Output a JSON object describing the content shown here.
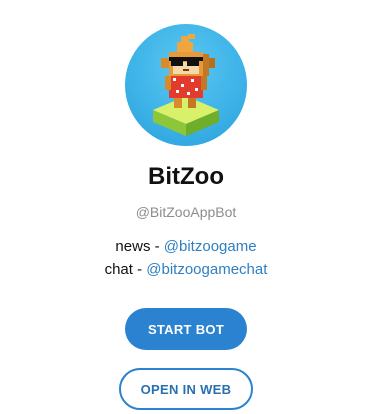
{
  "bot": {
    "name": "BitZoo",
    "username": "@BitZooAppBot",
    "avatar_icon": "voxel-monkey-with-sunglasses-avatar"
  },
  "description": {
    "news_prefix": "news - ",
    "news_link": "@bitzoogame",
    "chat_prefix": "chat - ",
    "chat_link": "@bitzoogamechat"
  },
  "actions": {
    "start_label": "START BOT",
    "web_label": "OPEN IN WEB"
  },
  "colors": {
    "accent": "#2a82d0",
    "link": "#2e7fc1",
    "muted": "#8d8d8d",
    "avatar_bg": "#3db3e8"
  }
}
